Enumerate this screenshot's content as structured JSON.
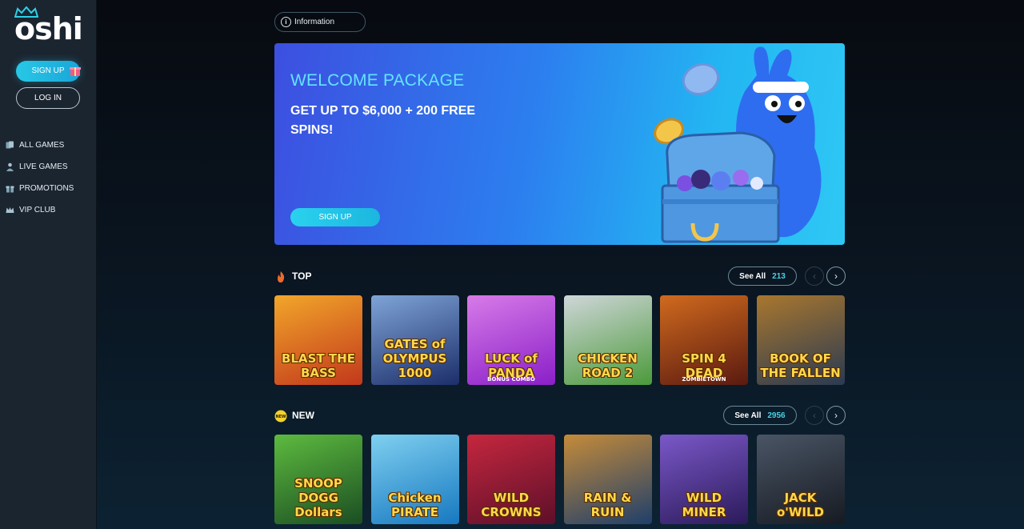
{
  "brand": {
    "logo_text": "oshi"
  },
  "sidebar": {
    "signup_label": "SIGN UP",
    "login_label": "LOG IN",
    "nav": [
      {
        "label": "ALL GAMES",
        "icon": "cards-icon"
      },
      {
        "label": "LIVE GAMES",
        "icon": "dealer-icon"
      },
      {
        "label": "PROMOTIONS",
        "icon": "gift-icon"
      },
      {
        "label": "VIP CLUB",
        "icon": "crown-icon"
      }
    ]
  },
  "info": {
    "label": "Information"
  },
  "banner": {
    "title": "WELCOME PACKAGE",
    "subtitle": "GET UP TO $6,000 + 200 FREE SPINS!",
    "button_label": "SIGN UP"
  },
  "sections": {
    "top": {
      "title": "TOP",
      "see_all_label": "See All",
      "count": "213",
      "games": [
        {
          "name": "BLAST THE BASS",
          "colors": [
            "#c2381c",
            "#f2a62a"
          ]
        },
        {
          "name": "GATES of OLYMPUS 1000",
          "colors": [
            "#1c2e6a",
            "#7fa4d6"
          ]
        },
        {
          "name": "LUCK of PANDA",
          "sub": "BONUS COMBO",
          "colors": [
            "#8a1fc8",
            "#d77be8"
          ]
        },
        {
          "name": "CHICKEN ROAD 2",
          "colors": [
            "#4b9a3a",
            "#cfd6d9"
          ]
        },
        {
          "name": "SPIN 4 DEAD",
          "sub": "ZOMBIETOWN",
          "colors": [
            "#5a1a10",
            "#d06a1e"
          ]
        },
        {
          "name": "BOOK OF THE FALLEN",
          "colors": [
            "#2a3a52",
            "#a9772e"
          ]
        }
      ]
    },
    "new": {
      "title": "NEW",
      "badge": "NEW",
      "see_all_label": "See All",
      "count": "2956",
      "games": [
        {
          "name": "SNOOP DOGG Dollars",
          "colors": [
            "#1b4d22",
            "#5dbb3f"
          ]
        },
        {
          "name": "Chicken PIRATE",
          "colors": [
            "#1678c0",
            "#7fd0f0"
          ]
        },
        {
          "name": "WILD CROWNS",
          "colors": [
            "#5d0f2a",
            "#c5273e"
          ]
        },
        {
          "name": "RAIN & RUIN",
          "colors": [
            "#1f3f6a",
            "#c58b3a"
          ]
        },
        {
          "name": "WILD MINER",
          "colors": [
            "#2b1a5a",
            "#7a58c8"
          ]
        },
        {
          "name": "JACK o'WILD",
          "colors": [
            "#161a22",
            "#4a5565"
          ]
        }
      ]
    }
  }
}
